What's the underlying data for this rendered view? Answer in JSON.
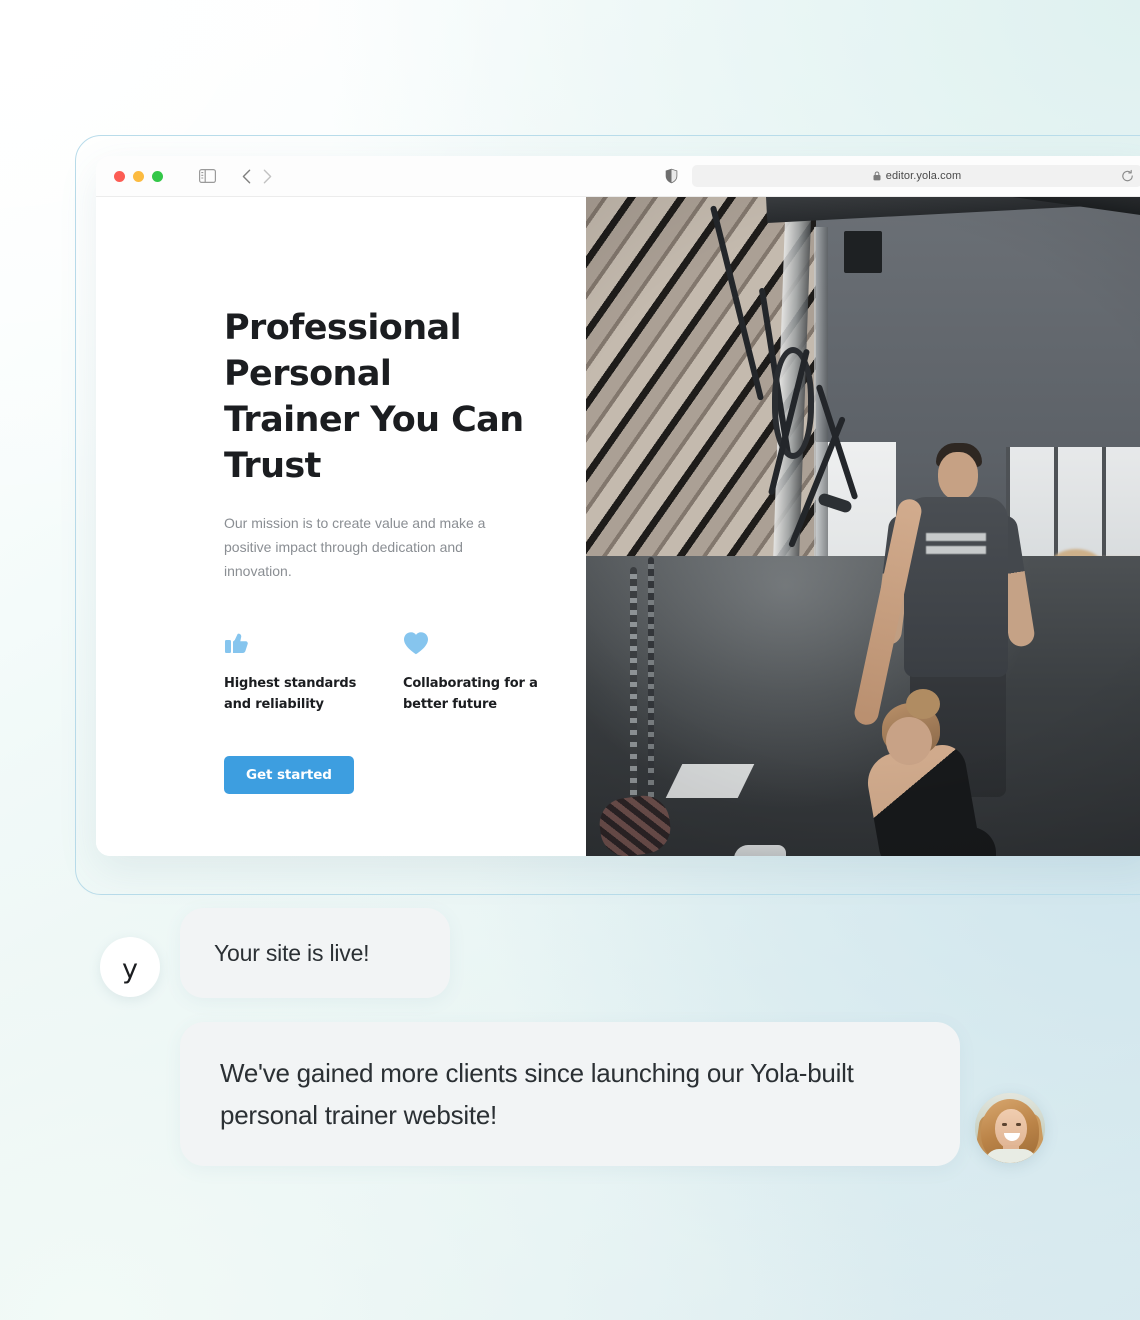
{
  "browser": {
    "traffic_lights": [
      "close",
      "minimize",
      "maximize"
    ],
    "sidebar_icon": "sidebar-icon",
    "back_icon": "chevron-left-icon",
    "forward_icon": "chevron-right-icon",
    "shield_icon": "privacy-shield-icon",
    "lock_icon": "lock-icon",
    "url": "editor.yola.com",
    "reload_icon": "reload-icon"
  },
  "site": {
    "hero": {
      "title": "Professional Personal Trainer You Can Trust",
      "subtitle": "Our mission is to create value and make a positive impact through dedication and innovation.",
      "cta_label": "Get started"
    },
    "features": [
      {
        "icon": "thumbs-up-icon",
        "text": "Highest standards and reliability"
      },
      {
        "icon": "heart-icon",
        "text": "Collaborating for a better future"
      }
    ],
    "photo_alt": "Personal trainer coaching a client using TRX straps in a gym"
  },
  "chat": {
    "brand_avatar_letter": "y",
    "messages": [
      {
        "text": "Your site is live!"
      },
      {
        "text": "We've gained more clients since launching our Yola-built personal trainer website!"
      }
    ],
    "client_avatar_alt": "Smiling woman client photo"
  },
  "colors": {
    "accent_blue": "#3d9ee0",
    "feature_icon_blue": "#86c5ee",
    "bubble_gray": "#f2f4f5",
    "heading_dark": "#1b1d20",
    "body_gray": "#8a8e93",
    "frame_border": "#b9dcea"
  }
}
